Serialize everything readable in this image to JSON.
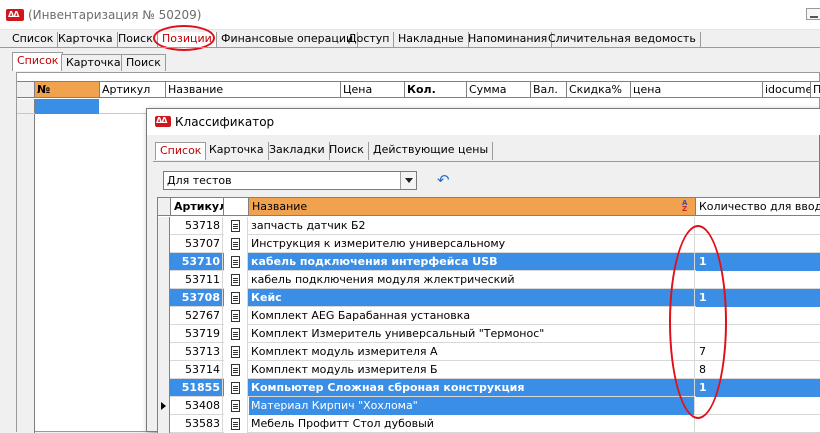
{
  "window": {
    "title": "(Инвентаризация № 50209)"
  },
  "top_tabs": [
    "Список",
    "Карточка",
    "Поиск",
    "Позиции",
    "Финансовые операции",
    "Доступ",
    "Накладные",
    "Напоминания",
    "Сличительная ведомость"
  ],
  "inner_tabs": [
    "Список",
    "Карточка",
    "Поиск"
  ],
  "positions_grid": {
    "columns": [
      "№",
      "Артикул",
      "Название",
      "Цена",
      "Кол.",
      "Сумма",
      "Вал.",
      "Скидка%",
      "цена",
      "idocumen",
      "П"
    ]
  },
  "dialog": {
    "title": "Классификатор",
    "tabs": [
      "Список",
      "Карточка",
      "Закладки",
      "Поиск",
      "Действующие цены"
    ],
    "filter_value": "Для тестов",
    "columns": {
      "article": "Артикул",
      "name": "Название",
      "qty": "Количество для ввода"
    },
    "rows": [
      {
        "article": "53718",
        "name": "запчасть датчик Б2",
        "qty": "",
        "highlight": false
      },
      {
        "article": "53707",
        "name": "Инструкция к измерителю универсальному",
        "qty": "",
        "highlight": false
      },
      {
        "article": "53710",
        "name": "кабель подключения интерфейса USB",
        "qty": "1",
        "highlight": true
      },
      {
        "article": "53711",
        "name": "кабель подключения модуля жлектрический",
        "qty": "",
        "highlight": false
      },
      {
        "article": "53708",
        "name": "Кейс",
        "qty": "1",
        "highlight": true
      },
      {
        "article": "52767",
        "name": "Комплект AEG Барабанная установка",
        "qty": "",
        "highlight": false
      },
      {
        "article": "53719",
        "name": "Комплект Измеритель универсальный \"Термонос\"",
        "qty": "",
        "highlight": false
      },
      {
        "article": "53713",
        "name": "Комплект модуль измерителя А",
        "qty": "7",
        "highlight": false
      },
      {
        "article": "53714",
        "name": "Комплект модуль измерителя Б",
        "qty": "8",
        "highlight": false
      },
      {
        "article": "51855",
        "name": "Компьютер Сложная сброная конструкция",
        "qty": "1",
        "highlight": true
      },
      {
        "article": "53408",
        "name": "Материал Кирпич \"Хохлома\"",
        "qty": "",
        "highlight": false,
        "current": true
      },
      {
        "article": "53583",
        "name": "Мебель Профитт Стол дубовый",
        "qty": "",
        "highlight": false
      }
    ]
  },
  "colors": {
    "accent_red": "#c00000",
    "selection_blue": "#3a8ee6",
    "header_orange": "#f0a24e",
    "annotation_red": "#e0101a"
  }
}
